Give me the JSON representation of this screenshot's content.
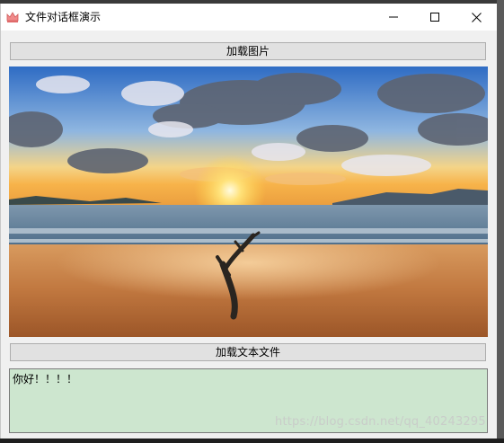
{
  "window": {
    "title": "文件对话框演示",
    "icon": "crown-icon",
    "controls": {
      "minimize": "minimize-icon",
      "maximize": "maximize-icon",
      "close": "close-icon"
    }
  },
  "main": {
    "load_image_label": "加载图片",
    "load_text_label": "加载文本文件",
    "image": {
      "description": "beach-sunset-with-driftwood",
      "colors": {
        "sky_top": "#3a78c9",
        "sun": "#ffd24a",
        "sand": "#c0773f",
        "sea": "#5d7d99"
      }
    },
    "text_content": "你好！！！！",
    "text_area_color": "#cde6cf"
  },
  "overlay": {
    "watermark": "https://blog.csdn.net/qq_40243295"
  }
}
